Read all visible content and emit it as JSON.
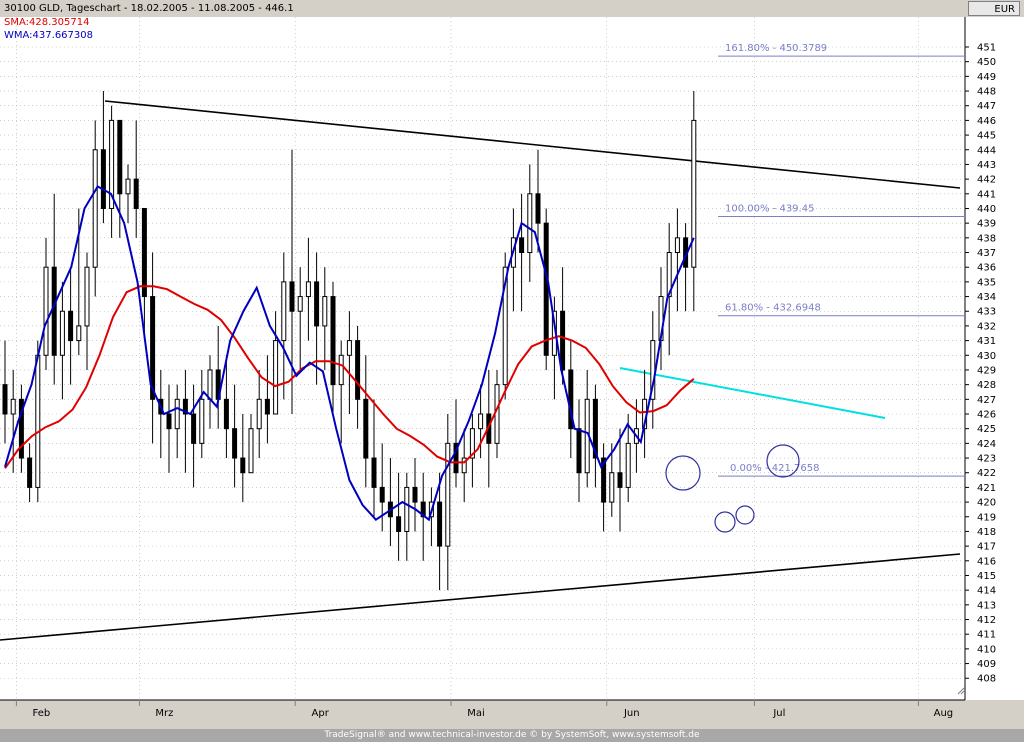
{
  "header": {
    "title": "30100  GLD, Tageschart - 18.02.2005 - 11.08.2005 - 446.1",
    "sma_label": "SMA:428.305714",
    "wma_label": "WMA:437.667308"
  },
  "currency": "EUR",
  "footer": "TradeSignal® and www.technical-investor.de © by SystemSoft, www.systemsoft.de",
  "colors": {
    "background": "#ffffff",
    "panel": "#d4d0c8",
    "candle": "#000000",
    "sma": "#e00000",
    "wma": "#0000c0",
    "fib": "#7a7fc8",
    "cyan_trend": "#00e0e0",
    "trendline": "#000000"
  },
  "chart_data": {
    "type": "candlestick",
    "title": "30100  GLD, Tageschart - 18.02.2005 - 11.08.2005 - 446.1",
    "ylim": [
      407,
      452
    ],
    "y_ticks": [
      408,
      409,
      410,
      411,
      412,
      413,
      414,
      415,
      416,
      417,
      418,
      419,
      420,
      421,
      422,
      423,
      424,
      425,
      426,
      427,
      428,
      429,
      430,
      431,
      432,
      433,
      434,
      435,
      436,
      437,
      438,
      439,
      440,
      441,
      442,
      443,
      444,
      445,
      446,
      447,
      448,
      449,
      450,
      451
    ],
    "x_labels": [
      "Feb",
      "Mrz",
      "Apr",
      "Mai",
      "Jun",
      "Jul",
      "Aug"
    ],
    "x_label_index": [
      2,
      17,
      36,
      55,
      74,
      92,
      112
    ],
    "grid": true,
    "candles": [
      [
        428,
        431,
        424,
        426
      ],
      [
        426,
        429,
        422,
        427
      ],
      [
        427,
        428,
        422,
        423
      ],
      [
        423,
        424,
        420,
        421
      ],
      [
        421,
        431,
        420,
        430
      ],
      [
        430,
        438,
        429,
        436
      ],
      [
        436,
        441,
        428,
        430
      ],
      [
        430,
        435,
        427,
        433
      ],
      [
        433,
        436,
        428,
        431
      ],
      [
        431,
        440,
        430,
        432
      ],
      [
        432,
        437,
        429,
        436
      ],
      [
        436,
        446,
        434,
        444
      ],
      [
        444,
        448,
        439,
        440
      ],
      [
        440,
        447,
        438,
        446
      ],
      [
        446,
        446,
        438,
        441
      ],
      [
        441,
        443,
        439,
        442
      ],
      [
        442,
        446,
        438,
        440
      ],
      [
        440,
        440,
        431,
        434
      ],
      [
        434,
        437,
        424,
        427
      ],
      [
        427,
        429,
        423,
        426
      ],
      [
        426,
        428,
        422,
        425
      ],
      [
        425,
        428,
        423,
        427
      ],
      [
        427,
        429,
        422,
        426
      ],
      [
        426,
        428,
        421,
        424
      ],
      [
        424,
        429,
        423,
        427
      ],
      [
        427,
        430,
        425,
        429
      ],
      [
        429,
        432,
        425,
        427
      ],
      [
        427,
        430,
        423,
        425
      ],
      [
        425,
        428,
        421,
        423
      ],
      [
        423,
        426,
        420,
        422
      ],
      [
        422,
        426,
        422,
        425
      ],
      [
        425,
        429,
        423,
        427
      ],
      [
        427,
        430,
        424,
        426
      ],
      [
        426,
        433,
        426,
        431
      ],
      [
        431,
        437,
        427,
        435
      ],
      [
        435,
        444,
        426,
        433
      ],
      [
        433,
        436,
        429,
        434
      ],
      [
        434,
        438,
        431,
        435
      ],
      [
        435,
        437,
        428,
        432
      ],
      [
        432,
        436,
        429,
        434
      ],
      [
        434,
        435,
        426,
        428
      ],
      [
        428,
        431,
        424,
        430
      ],
      [
        430,
        433,
        426,
        431
      ],
      [
        431,
        432,
        425,
        427
      ],
      [
        427,
        430,
        421,
        423
      ],
      [
        423,
        427,
        419,
        421
      ],
      [
        421,
        424,
        418,
        420
      ],
      [
        420,
        423,
        417,
        419
      ],
      [
        419,
        422,
        416,
        418
      ],
      [
        418,
        422,
        416,
        421
      ],
      [
        421,
        423,
        418,
        420
      ],
      [
        420,
        422,
        416,
        419
      ],
      [
        419,
        421,
        417,
        420
      ],
      [
        420,
        422,
        414,
        417
      ],
      [
        417,
        426,
        414,
        424
      ],
      [
        424,
        427,
        421,
        422
      ],
      [
        422,
        425,
        420,
        423
      ],
      [
        423,
        426,
        421,
        425
      ],
      [
        425,
        428,
        423,
        426
      ],
      [
        426,
        429,
        421,
        424
      ],
      [
        424,
        429,
        423,
        428
      ],
      [
        428,
        437,
        427,
        436
      ],
      [
        436,
        440,
        433,
        438
      ],
      [
        438,
        441,
        433,
        437
      ],
      [
        437,
        443,
        435,
        441
      ],
      [
        441,
        444,
        437,
        439
      ],
      [
        439,
        440,
        429,
        430
      ],
      [
        430,
        434,
        427,
        433
      ],
      [
        433,
        436,
        428,
        429
      ],
      [
        429,
        431,
        423,
        425
      ],
      [
        425,
        427,
        420,
        422
      ],
      [
        422,
        429,
        421,
        427
      ],
      [
        427,
        428,
        421,
        423
      ],
      [
        423,
        424,
        418,
        420
      ],
      [
        420,
        424,
        419,
        422
      ],
      [
        422,
        425,
        418,
        421
      ],
      [
        421,
        426,
        420,
        424
      ],
      [
        424,
        427,
        422,
        425
      ],
      [
        425,
        429,
        423,
        427
      ],
      [
        427,
        433,
        425,
        431
      ],
      [
        431,
        436,
        429,
        434
      ],
      [
        434,
        439,
        430,
        437
      ],
      [
        437,
        440,
        433,
        438
      ],
      [
        438,
        439,
        433,
        436
      ],
      [
        436,
        448,
        433,
        446
      ]
    ],
    "series": [
      {
        "name": "SMA",
        "color": "#e00000",
        "values": [
          422.3,
          423.6,
          424.5,
          425.1,
          425.5,
          426.3,
          427.8,
          430,
          432.6,
          434.3,
          434.7,
          434.7,
          434.5,
          434,
          433.5,
          433.1,
          432.4,
          431.2,
          429.8,
          428.5,
          427.9,
          428.2,
          429.1,
          429.6,
          429.6,
          429.3,
          428.2,
          427.1,
          426,
          425,
          424.5,
          423.9,
          423.1,
          422.7,
          422.7,
          423.6,
          425.5,
          427.5,
          429.4,
          430.6,
          431,
          431.3,
          431,
          430.5,
          429.4,
          427.9,
          426.8,
          426.1,
          426.2,
          426.6,
          427.6,
          428.4
        ]
      },
      {
        "name": "WMA",
        "color": "#0000c0",
        "values": [
          422.4,
          425.5,
          428,
          432,
          434,
          436,
          440,
          441.5,
          441,
          439,
          435,
          428,
          426,
          426.4,
          426,
          427.5,
          426.5,
          431,
          433,
          434.6,
          432,
          430.5,
          428.6,
          429.5,
          428.9,
          425,
          421.5,
          419.8,
          418.8,
          419.4,
          420,
          419.5,
          418.8,
          421.8,
          423.4,
          425.5,
          428,
          431.5,
          436,
          439,
          438.4,
          435,
          429,
          425,
          424.7,
          422.4,
          423.6,
          425.3,
          424.1,
          428.4,
          433.9,
          436,
          438
        ]
      }
    ],
    "fib_levels": [
      {
        "label": "161.80% - 450.3789",
        "value": 450.3789
      },
      {
        "label": "100.00% - 439.45",
        "value": 439.45
      },
      {
        "label": "61.80% - 432.6948",
        "value": 432.6948
      },
      {
        "label": "0.00% - 421.7658",
        "value": 421.7658
      }
    ]
  }
}
